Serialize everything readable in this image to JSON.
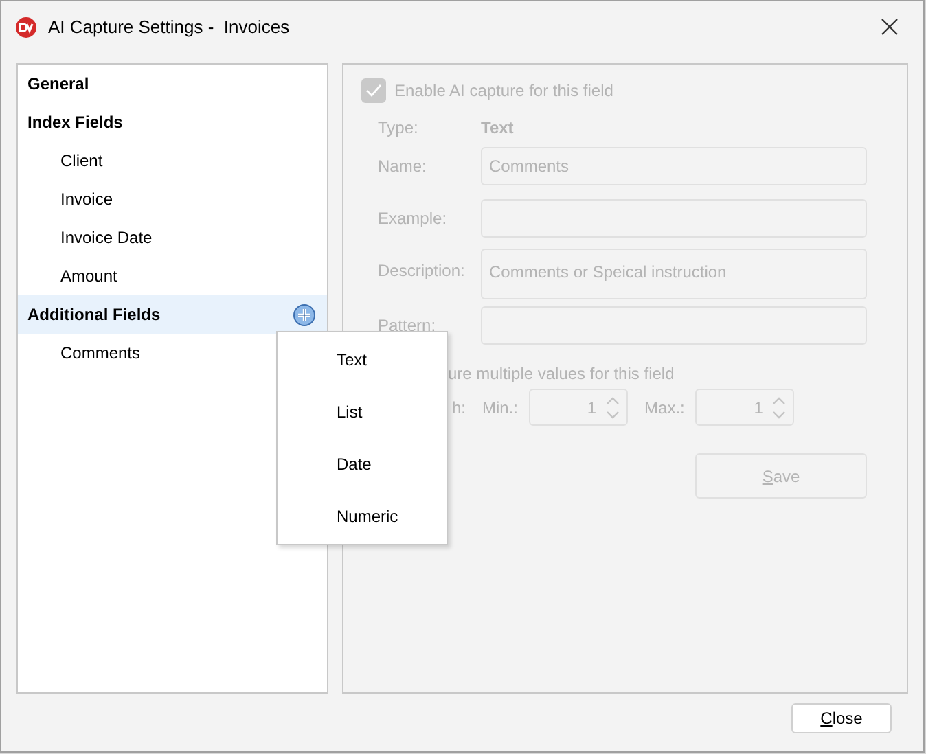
{
  "window": {
    "title": "AI Capture Settings -  Invoices"
  },
  "sidebar": {
    "items": [
      {
        "label": "General",
        "selected": false
      },
      {
        "label": "Index Fields",
        "selected": false,
        "children": [
          {
            "label": "Client",
            "selected": false
          },
          {
            "label": "Invoice",
            "selected": false
          },
          {
            "label": "Invoice Date",
            "selected": false
          },
          {
            "label": "Amount",
            "selected": false
          }
        ]
      },
      {
        "label": "Additional Fields",
        "selected": true,
        "add_button": true,
        "children": [
          {
            "label": "Comments",
            "selected": false
          }
        ]
      }
    ]
  },
  "menu": {
    "items": [
      "Text",
      "List",
      "Date",
      "Numeric"
    ]
  },
  "form": {
    "disabled": true,
    "enable": {
      "label": "Enable AI capture for this field",
      "checked": true
    },
    "type": {
      "label": "Type:",
      "value": "Text"
    },
    "fields": [
      {
        "label": "Name:",
        "value": "Comments",
        "kind": "line"
      },
      {
        "label": "Example:",
        "kind": "line"
      },
      {
        "label": "Description:",
        "value": "Comments or Speical instruction",
        "kind": "multiline"
      },
      {
        "label": "Pattern:",
        "kind": "line"
      }
    ],
    "multiple_label": "ure multiple values for this field",
    "length_label": "h:",
    "min": {
      "label": "Min.:",
      "value": "1"
    },
    "max": {
      "label": "Max.:",
      "value": "1"
    },
    "save": "Save"
  },
  "close": "Close"
}
